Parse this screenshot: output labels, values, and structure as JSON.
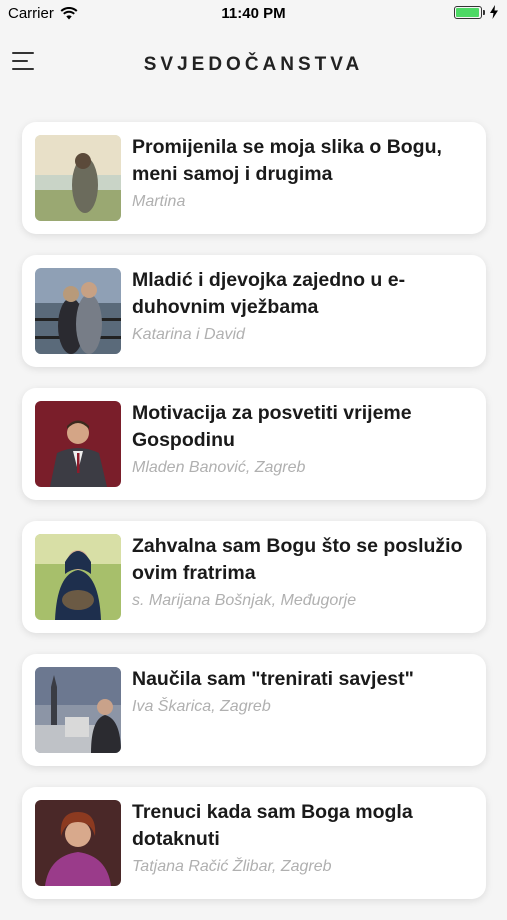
{
  "status": {
    "carrier": "Carrier",
    "time": "11:40 PM",
    "battery_level": 0.95
  },
  "header": {
    "title": "SVJEDOČANSTVA"
  },
  "items": [
    {
      "title": "Promijenila se moja slika o Bogu, meni samoj i drugima",
      "author": "Martina"
    },
    {
      "title": "Mladić i djevojka zajedno u e-duhovnim vježbama",
      "author": "Katarina i David"
    },
    {
      "title": "Motivacija za posvetiti vrijeme Gospodinu",
      "author": "Mladen Banović, Zagreb"
    },
    {
      "title": "Zahvalna sam Bogu što se poslužio ovim fratrima",
      "author": "s. Marijana Bošnjak, Međugorje"
    },
    {
      "title": "Naučila sam \"trenirati savjest\"",
      "author": "Iva Škarica, Zagreb"
    },
    {
      "title": "Trenuci kada sam Boga mogla dotaknuti",
      "author": "Tatjana Račić Žlibar, Zagreb"
    }
  ]
}
